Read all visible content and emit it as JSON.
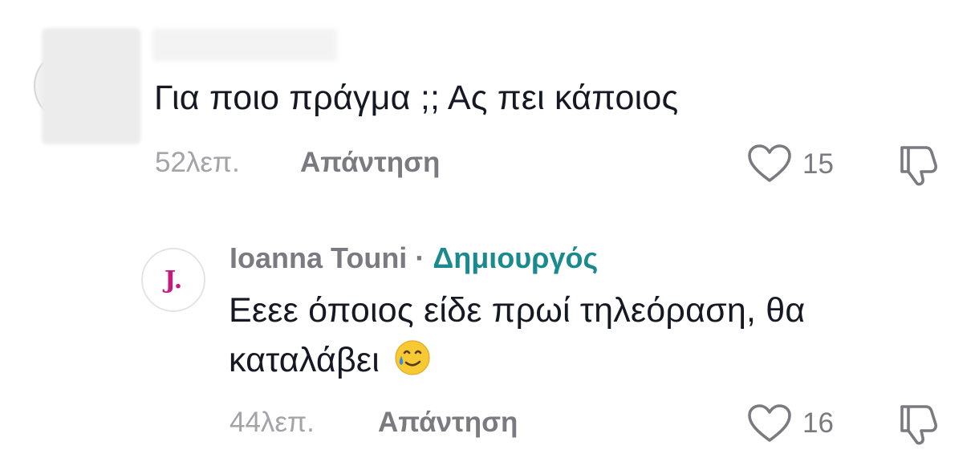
{
  "comments": [
    {
      "text": "Για ποιο πράγμα ;; Ας πει κάποιος",
      "time": "52λεπ.",
      "reply_label": "Απάντηση",
      "likes": "15",
      "like_icon": "heart-outline-icon",
      "dislike_icon": "thumbs-down-outline-icon"
    },
    {
      "author": "Ioanna Touni",
      "separator": "·",
      "badge": "Δημιουργός",
      "avatar_letter": "J.",
      "text_line1": "Εεεε όποιος είδε πρωί τηλεόραση, θα",
      "text_line2": "καταλάβει",
      "emoji": "smiling-face-with-tear",
      "time": "44λεπ.",
      "reply_label": "Απάντηση",
      "likes": "16",
      "like_icon": "heart-outline-icon",
      "dislike_icon": "thumbs-down-outline-icon"
    }
  ],
  "colors": {
    "text": "#161823",
    "muted": "#7a7a80",
    "time": "#a3a3a8",
    "creator_badge": "#1a8a8f",
    "avatar_letter": "#c8197f"
  }
}
